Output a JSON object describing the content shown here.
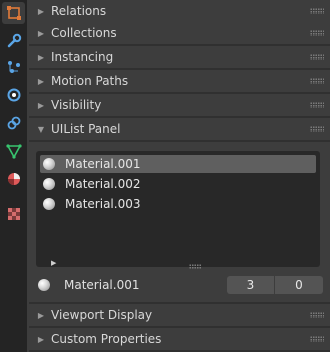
{
  "sidebar": {
    "tabs": [
      {
        "icon": "object-icon",
        "color": "#e07a3a",
        "active": true
      },
      {
        "icon": "wrench-icon",
        "color": "#5aa5e6"
      },
      {
        "icon": "particles-icon",
        "color": "#5aa5e6"
      },
      {
        "icon": "physics-icon",
        "color": "#5aa5e6"
      },
      {
        "icon": "constraint-icon",
        "color": "#5aa5e6"
      },
      {
        "icon": "data-icon",
        "color": "#38c56f"
      },
      {
        "icon": "material-icon",
        "color": "#e05a5a"
      },
      {
        "icon": "texture-icon",
        "color": "#d56c6c"
      }
    ]
  },
  "panels": {
    "relations": "Relations",
    "collections": "Collections",
    "instancing": "Instancing",
    "motion_paths": "Motion Paths",
    "visibility": "Visibility",
    "uilist": "UIList Panel",
    "viewport_display": "Viewport Display",
    "custom_properties": "Custom Properties"
  },
  "uilist": {
    "items": [
      "Material.001",
      "Material.002",
      "Material.003"
    ],
    "selected_index": 0,
    "active_name": "Material.001",
    "value_a": "3",
    "value_b": "0"
  }
}
